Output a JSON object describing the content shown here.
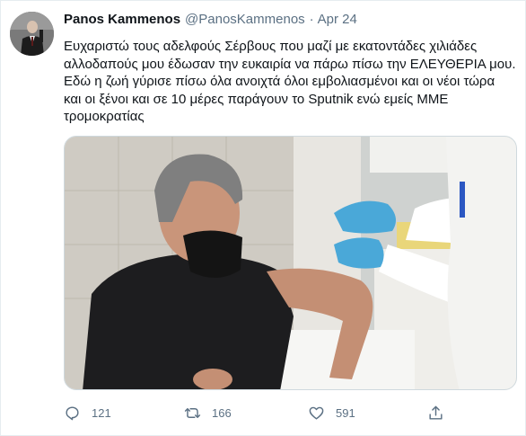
{
  "tweet": {
    "author": {
      "display_name": "Panos Kammenos",
      "handle": "@PanosKammenos",
      "separator": "·",
      "date": "Apr 24"
    },
    "text_lines": [
      "Ευχαριστώ τους αδελφούς Σέρβους που μαζί με εκατοντάδες χιλιάδες",
      "αλλοδαπούς μου έδωσαν την ευκαιρία να πάρω πίσω την ΕΛΕΥΘΕΡΙΑ μου.",
      "Εδώ η ζωή γύρισε πίσω όλα ανοιχτά όλοι εμβολιασμένοι και οι νέοι τώρα",
      "και οι ξένοι και σε 10 μέρες παράγουν το Sputnik ενώ εμείς ΜΜΕ",
      "τρομοκρατίας"
    ],
    "actions": {
      "reply_count": "121",
      "retweet_count": "166",
      "like_count": "591"
    },
    "icons": {
      "avatar": "profile-photo",
      "reply": "reply-icon",
      "retweet": "retweet-icon",
      "like": "heart-icon",
      "share": "share-icon"
    },
    "colors": {
      "secondary_text": "#5b7083",
      "primary_text": "#0f1419",
      "border": "#e6ecf0"
    }
  }
}
